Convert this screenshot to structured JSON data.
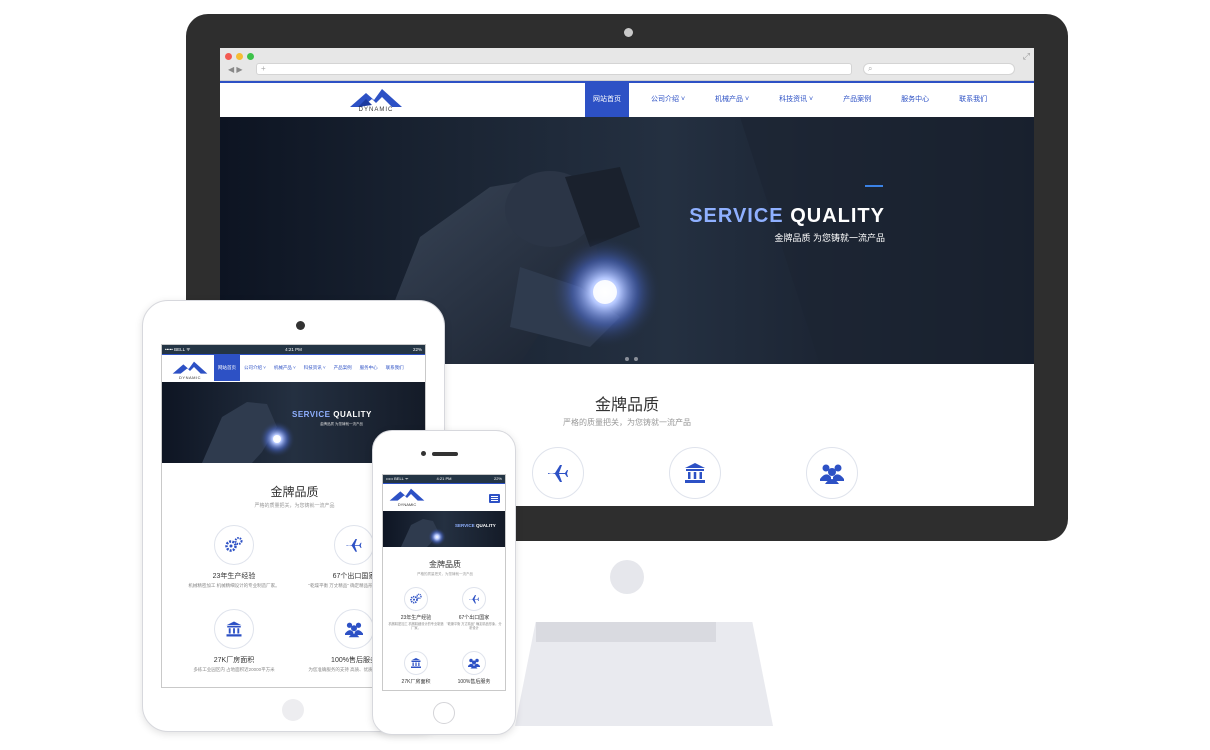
{
  "browser": {
    "url": "",
    "search_placeholder": ""
  },
  "site": {
    "logo_text": "DYNAMIC",
    "menu": [
      {
        "label": "网站首页",
        "active": true
      },
      {
        "label": "公司介绍 ˅"
      },
      {
        "label": "机械产品 ˅"
      },
      {
        "label": "科技资讯 ˅"
      },
      {
        "label": "产品案例"
      },
      {
        "label": "服务中心"
      },
      {
        "label": "联系我们"
      }
    ],
    "hero": {
      "title_highlight": "SERVICE",
      "title_rest": "QUALITY",
      "subtitle": "金牌品质 为您铸就一流产品"
    },
    "quality": {
      "title": "金牌品质",
      "subtitle": "严格的质量把关，为您铸就一流产品",
      "items": [
        {
          "icon": "gears-icon",
          "title": "23年生产经验",
          "desc": "机械精密加工 机械精细设计的专业制造厂家。"
        },
        {
          "icon": "airplane-icon",
          "title": "67个出口国家",
          "desc": "\"乾燥平衡 万丈精品\" 确定精品形象，分析设计"
        },
        {
          "icon": "bank-icon",
          "title": "27K厂房面积",
          "desc": "多栋工业园区内 占地面积近20000平方米"
        },
        {
          "icon": "users-icon",
          "title": "100%售后服务",
          "desc": "为您准确服务的支持 高质、优质，服务的产品"
        }
      ]
    }
  },
  "ipad": {
    "status_left": "••••• BELL ᯤ",
    "status_time": "4:21 PM",
    "status_right": "22%"
  },
  "iphone": {
    "status_left": "••••• BELL ᯤ",
    "status_time": "4:21 PM",
    "status_right": "22%"
  },
  "colors": {
    "brand": "#2d51c5",
    "accent": "#8fb0ff",
    "device_frame": "#2e2e2e"
  }
}
